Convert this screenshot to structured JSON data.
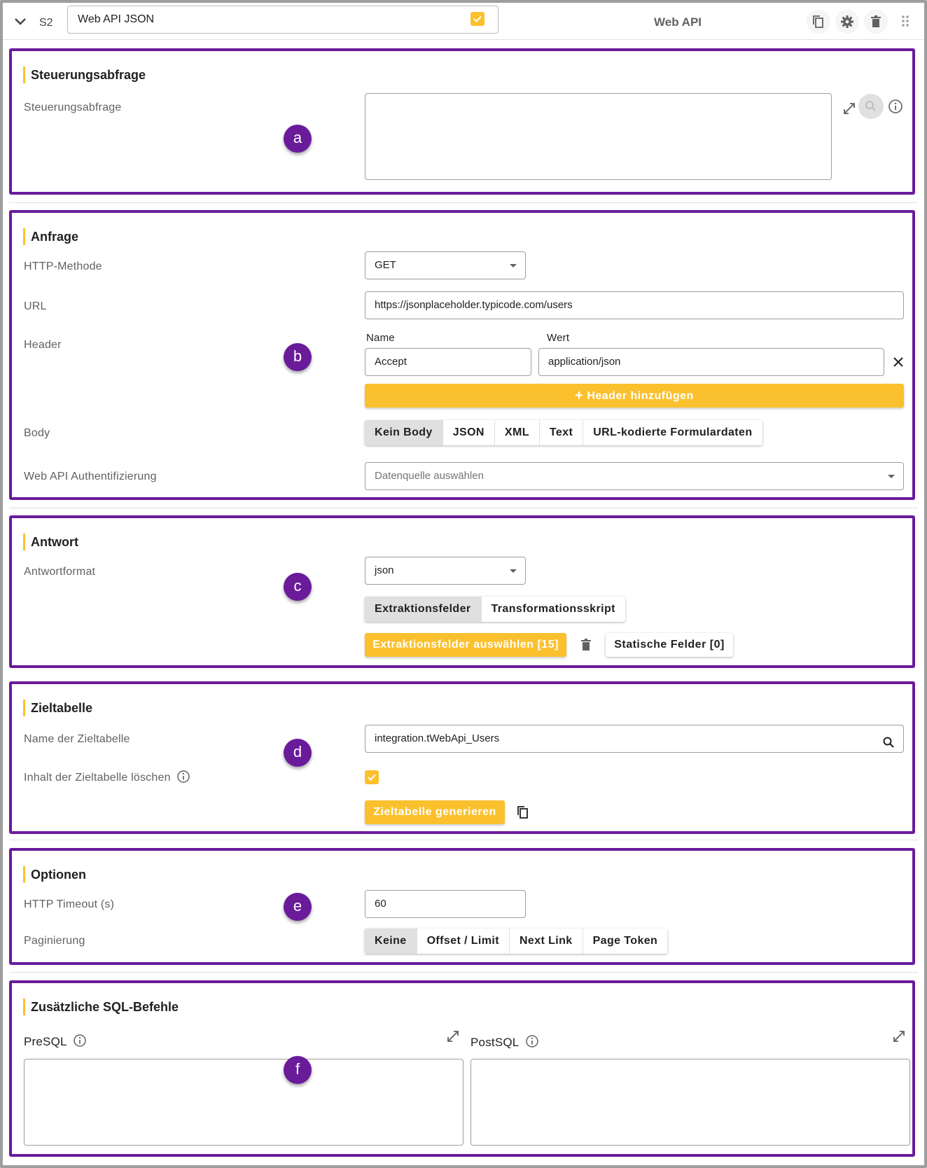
{
  "header": {
    "step_label": "S2",
    "step_name": "Web API JSON",
    "type_label": "Web API"
  },
  "sections": {
    "steuerung": {
      "title": "Steuerungsabfrage",
      "field_label": "Steuerungsabfrage",
      "query_value": "",
      "badge": "a"
    },
    "anfrage": {
      "title": "Anfrage",
      "http_method_label": "HTTP-Methode",
      "http_method_value": "GET",
      "url_label": "URL",
      "url_value": "https://jsonplaceholder.typicode.com/users",
      "header_label": "Header",
      "header_name_col": "Name",
      "header_value_col": "Wert",
      "header_name": "Accept",
      "header_value": "application/json",
      "add_header_button": "Header hinzufügen",
      "body_label": "Body",
      "body_options": [
        "Kein Body",
        "JSON",
        "XML",
        "Text",
        "URL-kodierte Formulardaten"
      ],
      "body_selected": "Kein Body",
      "auth_label": "Web API Authentifizierung",
      "auth_placeholder": "Datenquelle auswählen",
      "badge": "b"
    },
    "antwort": {
      "title": "Antwort",
      "format_label": "Antwortformat",
      "format_value": "json",
      "tabs": [
        "Extraktionsfelder",
        "Transformationsskript"
      ],
      "tab_selected": "Extraktionsfelder",
      "select_fields_button": "Extraktionsfelder auswählen [15]",
      "static_fields_button": "Statische Felder [0]",
      "badge": "c"
    },
    "ziel": {
      "title": "Zieltabelle",
      "name_label": "Name der Zieltabelle",
      "name_value": "integration.tWebApi_Users",
      "clear_label": "Inhalt der Zieltabelle löschen",
      "clear_checked": true,
      "generate_button": "Zieltabelle generieren",
      "badge": "d"
    },
    "optionen": {
      "title": "Optionen",
      "timeout_label": "HTTP Timeout (s)",
      "timeout_value": "60",
      "paging_label": "Paginierung",
      "paging_options": [
        "Keine",
        "Offset / Limit",
        "Next Link",
        "Page Token"
      ],
      "paging_selected": "Keine",
      "badge": "e"
    },
    "sql": {
      "title": "Zusätzliche SQL-Befehle",
      "presql_label": "PreSQL",
      "postsql_label": "PostSQL",
      "presql_value": "",
      "postsql_value": "",
      "badge": "f"
    }
  },
  "colors": {
    "accent": "#fbc02d",
    "highlight_border": "#6a1b9a",
    "badge": "#6a1b9a"
  }
}
